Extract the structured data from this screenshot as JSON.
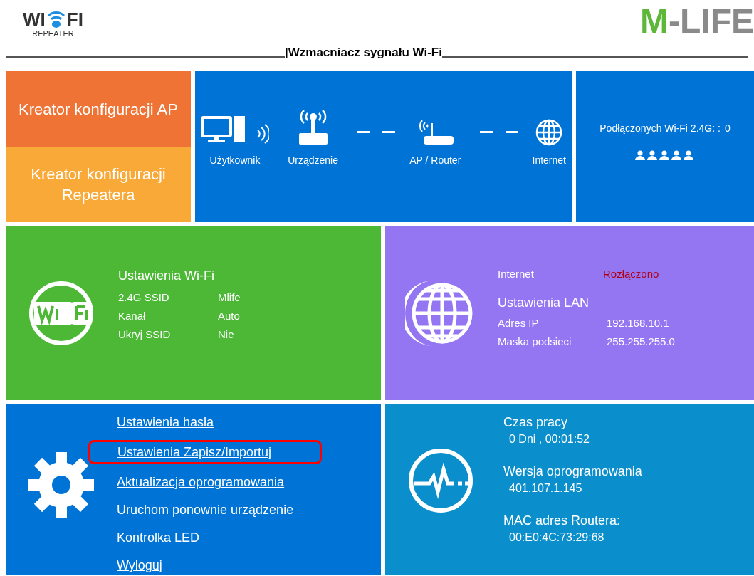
{
  "header": {
    "logo_left": "WI",
    "logo_right": "FI",
    "logo_sub": "REPEATER",
    "title": "|Wzmacniacz sygnału Wi-Fi",
    "brand_mark": "M",
    "brand_rest": "-LIFE"
  },
  "wizards": [
    {
      "label": "Kreator konfiguracji AP",
      "color": "#ee7335"
    },
    {
      "label": "Kreator konfiguracji Repeatera",
      "color": "#f9a937"
    }
  ],
  "topology": {
    "nodes": [
      {
        "kind": "user",
        "label": "Użytkownik"
      },
      {
        "kind": "device",
        "label": "Urządzenie"
      },
      {
        "kind": "router",
        "label": "AP / Router"
      },
      {
        "kind": "internet",
        "label": "Internet"
      }
    ]
  },
  "clients": {
    "label": "Podłączonych Wi-Fi 2.4G: :",
    "count": "0"
  },
  "wifi": {
    "link": "Ustawienia Wi-Fi",
    "rows": [
      {
        "label": "2.4G SSID",
        "value": "Mlife"
      },
      {
        "label": "Kanał",
        "value": "Auto"
      },
      {
        "label": "Ukryj SSID",
        "value": "Nie"
      }
    ]
  },
  "lan": {
    "internet_label": "Internet",
    "internet_value": "Rozłączono",
    "link": "Ustawienia LAN",
    "rows": [
      {
        "label": "Adres IP",
        "value": "192.168.10.1"
      },
      {
        "label": "Maska podsieci",
        "value": "255.255.255.0"
      }
    ]
  },
  "system": {
    "links": [
      {
        "label": "Ustawienia hasła",
        "highlighted": false
      },
      {
        "label": "Ustawienia Zapisz/Importuj",
        "highlighted": true
      },
      {
        "label": "Aktualizacja oprogramowania",
        "highlighted": false
      },
      {
        "label": "Uruchom ponownie urządzenie",
        "highlighted": false
      },
      {
        "label": "Kontrolka LED",
        "highlighted": false
      },
      {
        "label": "Wyloguj",
        "highlighted": false
      }
    ]
  },
  "status": {
    "items": [
      {
        "label": "Czas pracy",
        "value": "0 Dni , 00:01:52"
      },
      {
        "label": "Wersja oprogramowania",
        "value": "401.107.1.145"
      },
      {
        "label": "MAC adres Routera:",
        "value": "00:E0:4C:73:29:68"
      }
    ]
  }
}
